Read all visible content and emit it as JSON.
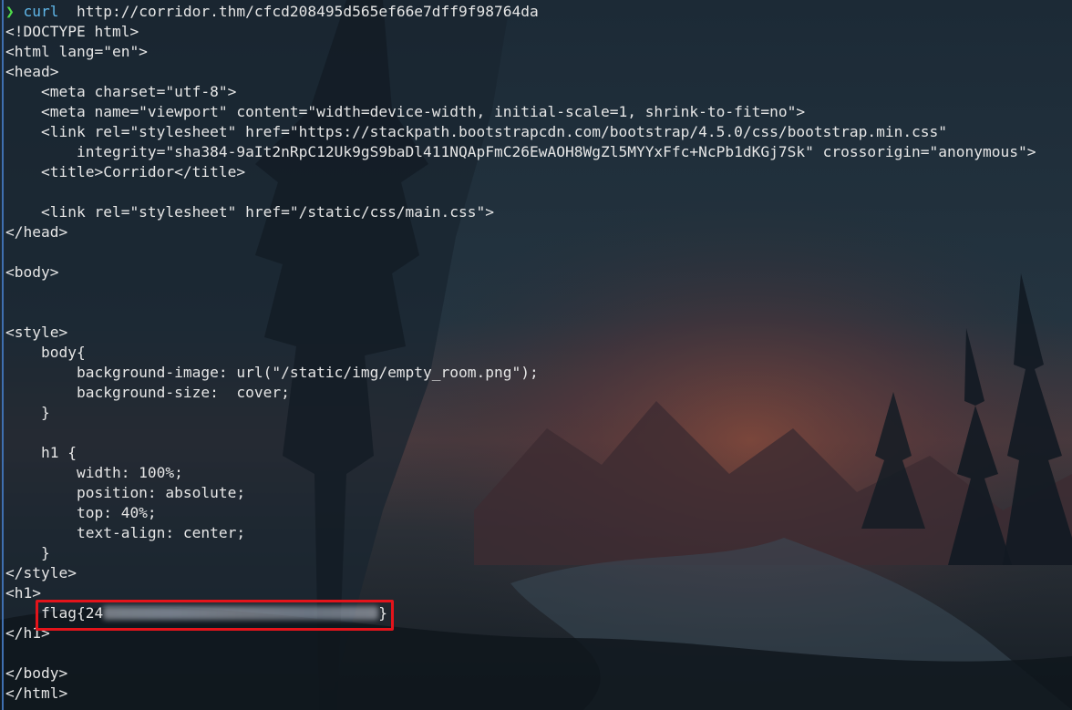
{
  "prompt": {
    "arrow": "❯",
    "command": "curl",
    "argument": "  http://corridor.thm/cfcd208495d565ef66e7dff9f98764da"
  },
  "output_lines": [
    "<!DOCTYPE html>",
    "<html lang=\"en\">",
    "<head>",
    "    <meta charset=\"utf-8\">",
    "    <meta name=\"viewport\" content=\"width=device-width, initial-scale=1, shrink-to-fit=no\">",
    "    <link rel=\"stylesheet\" href=\"https://stackpath.bootstrapcdn.com/bootstrap/4.5.0/css/bootstrap.min.css\"",
    "        integrity=\"sha384-9aIt2nRpC12Uk9gS9baDl411NQApFmC26EwAOH8WgZl5MYYxFfc+NcPb1dKGj7Sk\" crossorigin=\"anonymous\">",
    "    <title>Corridor</title>",
    "",
    "    <link rel=\"stylesheet\" href=\"/static/css/main.css\">",
    "</head>",
    "",
    "<body>",
    "",
    "",
    "<style>",
    "    body{",
    "        background-image: url(\"/static/img/empty_room.png\");",
    "        background-size:  cover;",
    "    }",
    "",
    "    h1 {",
    "        width: 100%;",
    "        position: absolute;",
    "        top: 40%;",
    "        text-align: center;",
    "    }",
    "</style>",
    "<h1>"
  ],
  "flag": {
    "prefix": "    flag{24",
    "suffix": "}"
  },
  "tail_lines": [
    "</h1>",
    "",
    "</body>",
    "</html>"
  ],
  "colors": {
    "prompt_arrow": "#4fdc4a",
    "command": "#5fb6e8",
    "text": "#e6e6e6",
    "highlight_border": "#e3141b"
  }
}
